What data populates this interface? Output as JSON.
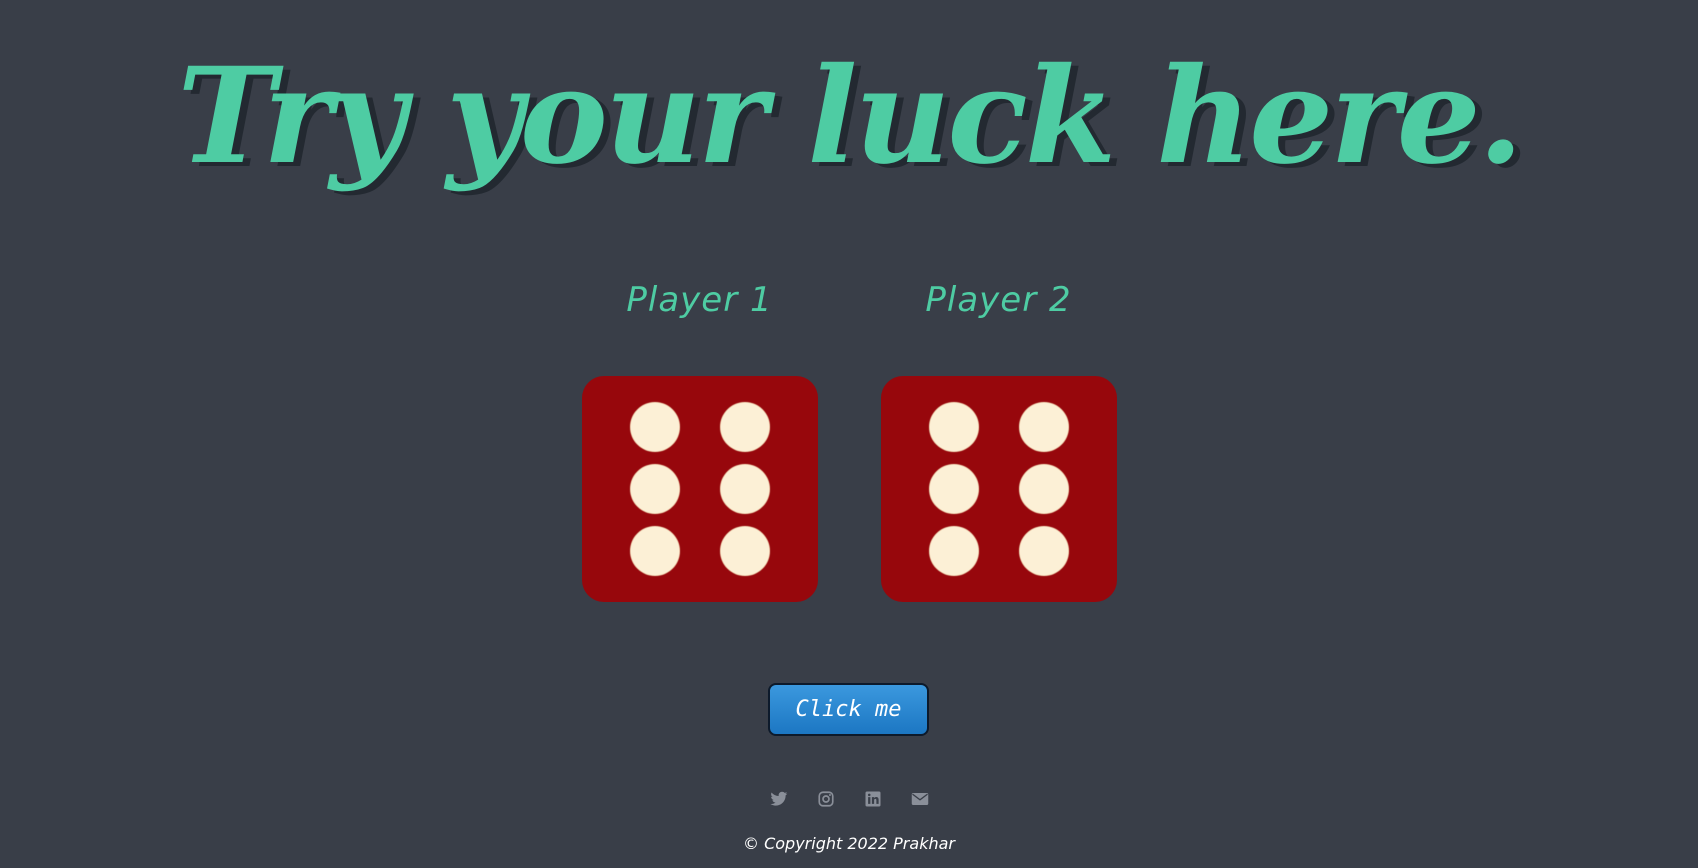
{
  "title": "Try your luck here.",
  "players": [
    {
      "name": "Player 1",
      "die_value": 6
    },
    {
      "name": "Player 2",
      "die_value": 6
    }
  ],
  "button": {
    "label": "Click me"
  },
  "social": [
    {
      "name": "twitter-icon"
    },
    {
      "name": "instagram-icon"
    },
    {
      "name": "linkedin-icon"
    },
    {
      "name": "mail-icon"
    }
  ],
  "footer": {
    "copyright": "© Copyright 2022 Prakhar"
  },
  "colors": {
    "background": "#393e48",
    "accent": "#4ecca3",
    "die": "#97070c",
    "pip": "#fcf0d6",
    "button": "#2a88d2",
    "icon": "#8a8f99"
  }
}
